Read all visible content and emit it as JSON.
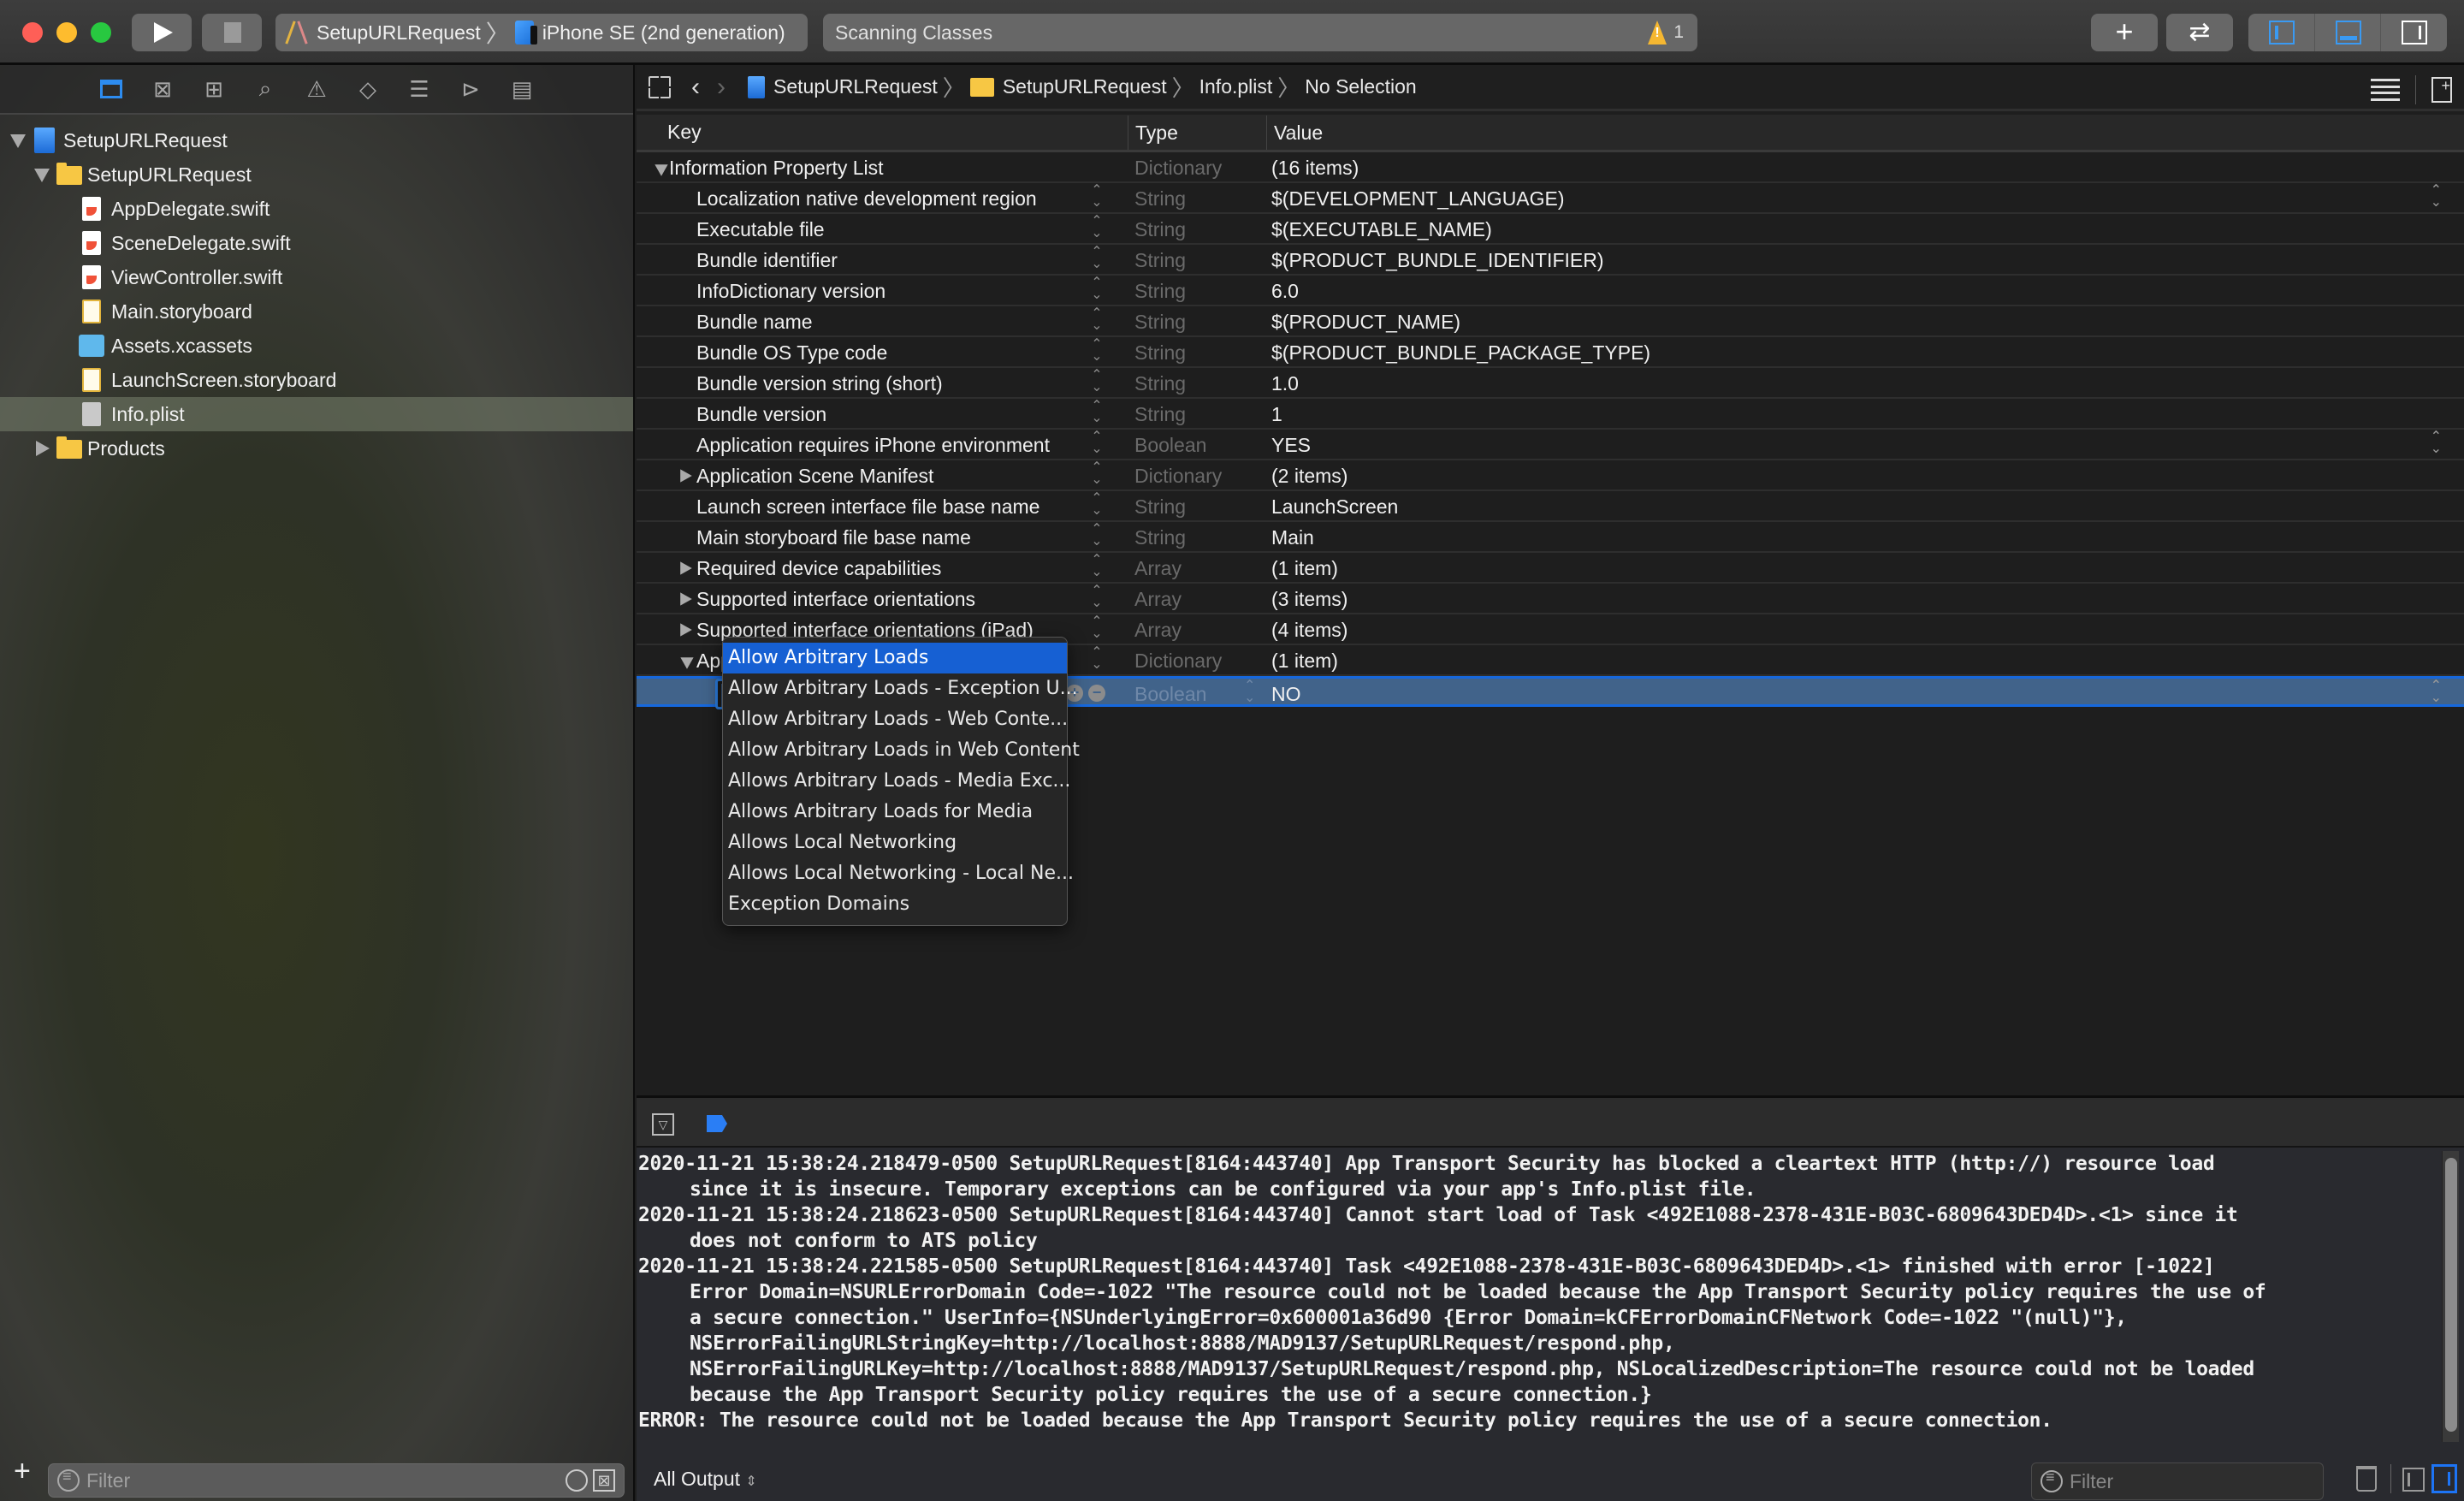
{
  "window": {
    "scheme": {
      "project": "SetupURLRequest",
      "device": "iPhone SE (2nd generation)"
    },
    "activity": {
      "status": "Scanning Classes",
      "warning_count": "1"
    },
    "toolbar": {
      "add_label": "+",
      "swap_label": "⇄"
    }
  },
  "navigator": {
    "icons": [
      "project-navigator",
      "source-control-navigator",
      "symbol-navigator",
      "find-navigator",
      "issue-navigator",
      "test-navigator",
      "debug-navigator",
      "breakpoint-navigator",
      "report-navigator"
    ],
    "tree": [
      {
        "label": "SetupURLRequest",
        "type": "project",
        "depth": 0,
        "expanded": true
      },
      {
        "label": "SetupURLRequest",
        "type": "folder",
        "depth": 1,
        "expanded": true
      },
      {
        "label": "AppDelegate.swift",
        "type": "swift",
        "depth": 2
      },
      {
        "label": "SceneDelegate.swift",
        "type": "swift",
        "depth": 2
      },
      {
        "label": "ViewController.swift",
        "type": "swift",
        "depth": 2
      },
      {
        "label": "Main.storyboard",
        "type": "storyboard",
        "depth": 2
      },
      {
        "label": "Assets.xcassets",
        "type": "assets",
        "depth": 2
      },
      {
        "label": "LaunchScreen.storyboard",
        "type": "storyboard",
        "depth": 2
      },
      {
        "label": "Info.plist",
        "type": "plist",
        "depth": 2,
        "selected": true
      },
      {
        "label": "Products",
        "type": "folder",
        "depth": 1,
        "expanded": false
      }
    ],
    "filter_placeholder": "Filter"
  },
  "jumpbar": {
    "crumbs": [
      "SetupURLRequest",
      "SetupURLRequest",
      "Info.plist",
      "No Selection"
    ]
  },
  "plist": {
    "headers": {
      "key": "Key",
      "type": "Type",
      "value": "Value"
    },
    "rows": [
      {
        "key": "Information Property List",
        "type": "Dictionary",
        "value": "(16 items)",
        "level": "root",
        "toggle": "down"
      },
      {
        "key": "Localization native development region",
        "type": "String",
        "value": "$(DEVELOPMENT_LANGUAGE)",
        "level": "item",
        "value_stepper": true
      },
      {
        "key": "Executable file",
        "type": "String",
        "value": "$(EXECUTABLE_NAME)",
        "level": "item"
      },
      {
        "key": "Bundle identifier",
        "type": "String",
        "value": "$(PRODUCT_BUNDLE_IDENTIFIER)",
        "level": "item"
      },
      {
        "key": "InfoDictionary version",
        "type": "String",
        "value": "6.0",
        "level": "item"
      },
      {
        "key": "Bundle name",
        "type": "String",
        "value": "$(PRODUCT_NAME)",
        "level": "item"
      },
      {
        "key": "Bundle OS Type code",
        "type": "String",
        "value": "$(PRODUCT_BUNDLE_PACKAGE_TYPE)",
        "level": "item"
      },
      {
        "key": "Bundle version string (short)",
        "type": "String",
        "value": "1.0",
        "level": "item"
      },
      {
        "key": "Bundle version",
        "type": "String",
        "value": "1",
        "level": "item"
      },
      {
        "key": "Application requires iPhone environment",
        "type": "Boolean",
        "value": "YES",
        "level": "item",
        "value_stepper": true
      },
      {
        "key": "Application Scene Manifest",
        "type": "Dictionary",
        "value": "(2 items)",
        "level": "item",
        "toggle": "right"
      },
      {
        "key": "Launch screen interface file base name",
        "type": "String",
        "value": "LaunchScreen",
        "level": "item"
      },
      {
        "key": "Main storyboard file base name",
        "type": "String",
        "value": "Main",
        "level": "item"
      },
      {
        "key": "Required device capabilities",
        "type": "Array",
        "value": "(1 item)",
        "level": "item",
        "toggle": "right"
      },
      {
        "key": "Supported interface orientations",
        "type": "Array",
        "value": "(3 items)",
        "level": "item",
        "toggle": "right"
      },
      {
        "key": "Supported interface orientations (iPad)",
        "type": "Array",
        "value": "(4 items)",
        "level": "item",
        "toggle": "right"
      },
      {
        "key": "App Transport Security Settings",
        "type": "Dictionary",
        "value": "(1 item)",
        "level": "item",
        "toggle": "down"
      }
    ],
    "editing_row": {
      "key": "Allow Arbitrary Loads",
      "type": "Boolean",
      "value": "NO"
    },
    "suggestions": [
      "Allow Arbitrary Loads",
      "Allow Arbitrary Loads - Exception U...",
      "Allow Arbitrary Loads - Web Conte...",
      "Allow Arbitrary Loads in Web Content",
      "Allows Arbitrary Loads - Media Exc...",
      "Allows Arbitrary Loads for Media",
      "Allows Local Networking",
      "Allows Local Networking - Local Ne...",
      "Exception Domains"
    ],
    "highlighted_suggestion": 0
  },
  "console": {
    "lines": [
      {
        "text": "2020-11-21 15:38:24.218479-0500 SetupURLRequest[8164:443740] App Transport Security has blocked a cleartext HTTP (http://) resource load",
        "cont": false
      },
      {
        "text": "since it is insecure. Temporary exceptions can be configured via your app's Info.plist file.",
        "cont": true
      },
      {
        "text": "2020-11-21 15:38:24.218623-0500 SetupURLRequest[8164:443740] Cannot start load of Task <492E1088-2378-431E-B03C-6809643DED4D>.<1> since it",
        "cont": false
      },
      {
        "text": "does not conform to ATS policy",
        "cont": true
      },
      {
        "text": "2020-11-21 15:38:24.221585-0500 SetupURLRequest[8164:443740] Task <492E1088-2378-431E-B03C-6809643DED4D>.<1> finished with error [-1022]",
        "cont": false
      },
      {
        "text": "Error Domain=NSURLErrorDomain Code=-1022 \"The resource could not be loaded because the App Transport Security policy requires the use of",
        "cont": true
      },
      {
        "text": "a secure connection.\" UserInfo={NSUnderlyingError=0x600001a36d90 {Error Domain=kCFErrorDomainCFNetwork Code=-1022 \"(null)\"},",
        "cont": true
      },
      {
        "text": "NSErrorFailingURLStringKey=http://localhost:8888/MAD9137/SetupURLRequest/respond.php,",
        "cont": true
      },
      {
        "text": "NSErrorFailingURLKey=http://localhost:8888/MAD9137/SetupURLRequest/respond.php, NSLocalizedDescription=The resource could not be loaded",
        "cont": true
      },
      {
        "text": "because the App Transport Security policy requires the use of a secure connection.}",
        "cont": true
      },
      {
        "text": "ERROR: The resource could not be loaded because the App Transport Security policy requires the use of a secure connection.",
        "cont": false
      }
    ],
    "scope": "All Output",
    "filter_placeholder": "Filter"
  },
  "colors": {
    "accent": "#1660d3",
    "selection_row": "#41638a",
    "warning": "#f5b731",
    "editor_bg": "#1e1e1e",
    "console_bg": "#292a2f"
  }
}
